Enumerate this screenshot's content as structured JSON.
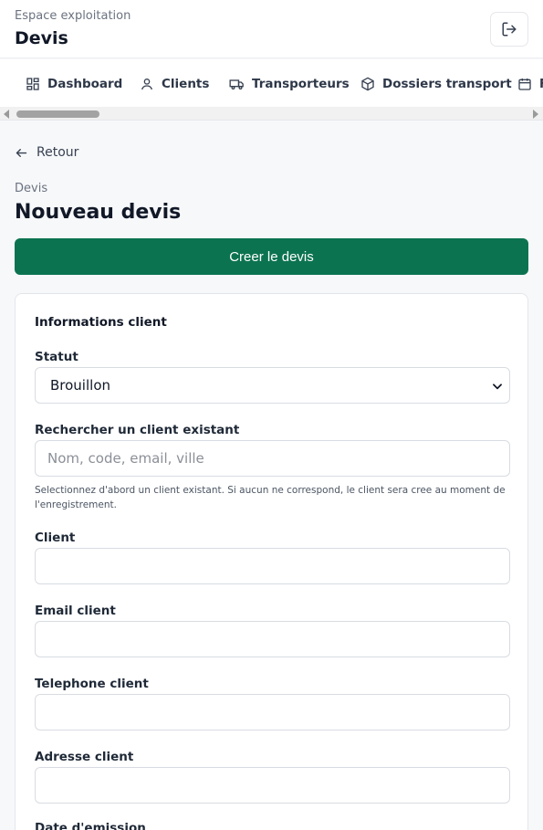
{
  "header": {
    "kicker": "Espace exploitation",
    "title": "Devis",
    "logout_icon": "logout-icon"
  },
  "nav": {
    "items": [
      {
        "label": "Dashboard",
        "icon": "dashboard-icon"
      },
      {
        "label": "Clients",
        "icon": "user-icon"
      },
      {
        "label": "Transporteurs",
        "icon": "truck-icon"
      },
      {
        "label": "Dossiers transport",
        "icon": "package-icon"
      },
      {
        "label": "F",
        "icon": "calendar-icon"
      }
    ]
  },
  "back": {
    "label": "Retour",
    "icon": "arrow-left-icon"
  },
  "breadcrumb": "Devis",
  "page_title": "Nouveau devis",
  "create_button": "Creer le devis",
  "colors": {
    "accent": "#0c7351"
  },
  "form": {
    "section_title": "Informations client",
    "status": {
      "label": "Statut",
      "value": "Brouillon"
    },
    "search": {
      "label": "Rechercher un client existant",
      "placeholder": "Nom, code, email, ville",
      "help": "Selectionnez d'abord un client existant. Si aucun ne correspond, le client sera cree au moment de l'enregistrement."
    },
    "client": {
      "label": "Client",
      "value": ""
    },
    "email": {
      "label": "Email client",
      "value": ""
    },
    "phone": {
      "label": "Telephone client",
      "value": ""
    },
    "address": {
      "label": "Adresse client",
      "value": ""
    },
    "date": {
      "label": "Date d'emission"
    }
  }
}
